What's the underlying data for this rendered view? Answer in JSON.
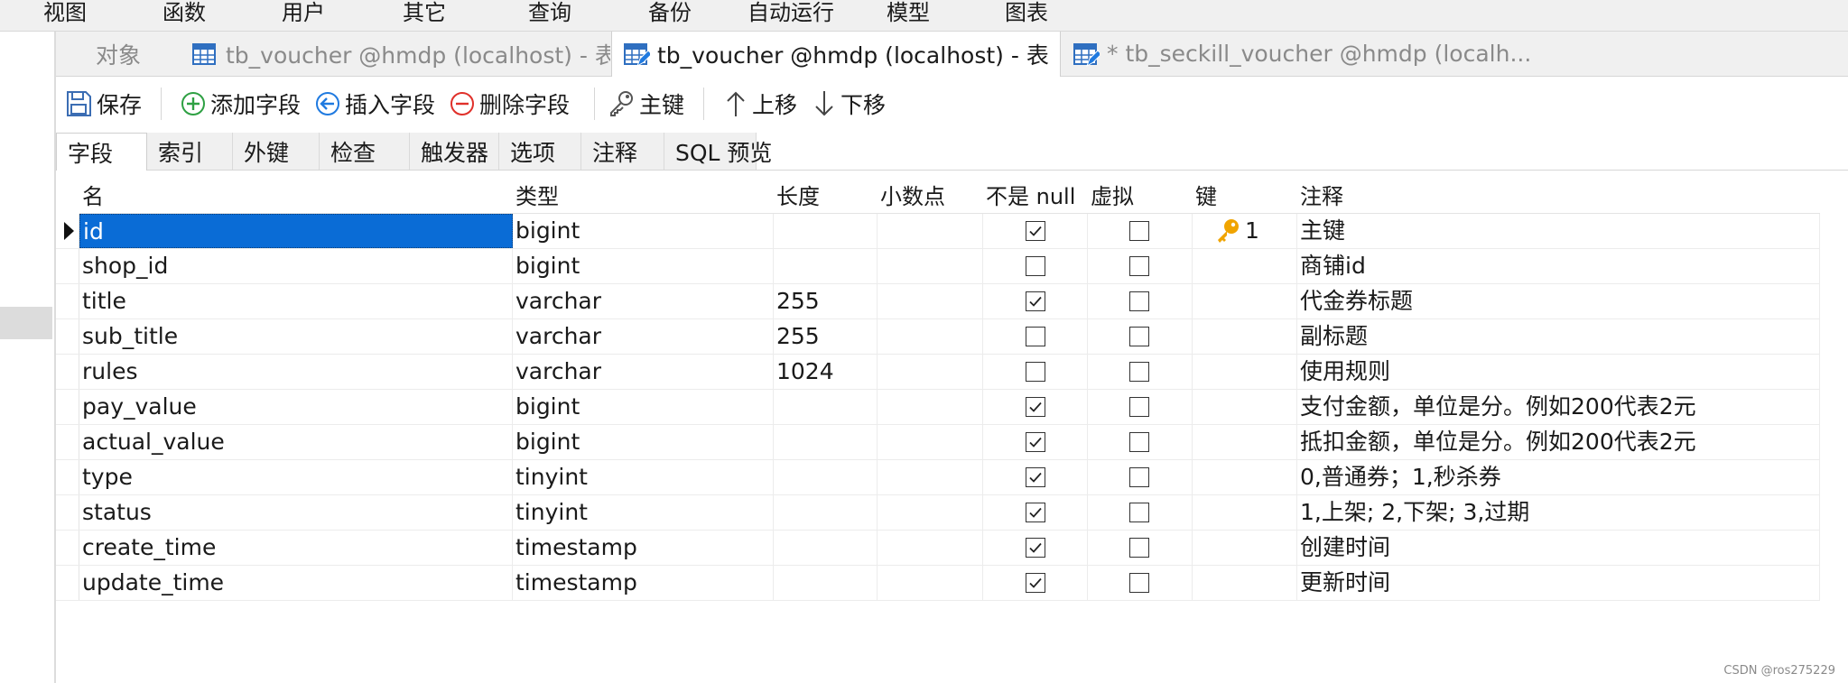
{
  "menu": [
    "视图",
    "函数",
    "用户",
    "其它",
    "查询",
    "备份",
    "自动运行",
    "模型",
    "图表"
  ],
  "tabs": [
    {
      "label": "对象",
      "state": "inactive"
    },
    {
      "label": "tb_voucher @hmdp (localhost) - 表",
      "state": "inactive",
      "icon": "table-icon"
    },
    {
      "label": "tb_voucher @hmdp (localhost) - 表",
      "state": "active",
      "icon": "table-design-icon"
    },
    {
      "label": "* tb_seckill_voucher @hmdp (localh...",
      "state": "inactive",
      "icon": "table-design-icon"
    }
  ],
  "toolbar": {
    "save": "保存",
    "add_field": "添加字段",
    "insert_field": "插入字段",
    "delete_field": "删除字段",
    "primary_key": "主键",
    "move_up": "上移",
    "move_down": "下移"
  },
  "sub_tabs": [
    "字段",
    "索引",
    "外键",
    "检查",
    "触发器",
    "选项",
    "注释",
    "SQL 预览"
  ],
  "columns": [
    "名",
    "类型",
    "长度",
    "小数点",
    "不是 null",
    "虚拟",
    "键",
    "注释"
  ],
  "rows": [
    {
      "name": "id",
      "type": "bigint",
      "length": "",
      "not_null": true,
      "virtual": false,
      "key": "1",
      "comment": "主键"
    },
    {
      "name": "shop_id",
      "type": "bigint",
      "length": "",
      "not_null": false,
      "virtual": false,
      "key": "",
      "comment": "商铺id"
    },
    {
      "name": "title",
      "type": "varchar",
      "length": "255",
      "not_null": true,
      "virtual": false,
      "key": "",
      "comment": "代金券标题"
    },
    {
      "name": "sub_title",
      "type": "varchar",
      "length": "255",
      "not_null": false,
      "virtual": false,
      "key": "",
      "comment": "副标题"
    },
    {
      "name": "rules",
      "type": "varchar",
      "length": "1024",
      "not_null": false,
      "virtual": false,
      "key": "",
      "comment": "使用规则"
    },
    {
      "name": "pay_value",
      "type": "bigint",
      "length": "",
      "not_null": true,
      "virtual": false,
      "key": "",
      "comment": "支付金额，单位是分。例如200代表2元"
    },
    {
      "name": "actual_value",
      "type": "bigint",
      "length": "",
      "not_null": true,
      "virtual": false,
      "key": "",
      "comment": "抵扣金额，单位是分。例如200代表2元"
    },
    {
      "name": "type",
      "type": "tinyint",
      "length": "",
      "not_null": true,
      "virtual": false,
      "key": "",
      "comment": "0,普通券；1,秒杀券"
    },
    {
      "name": "status",
      "type": "tinyint",
      "length": "",
      "not_null": true,
      "virtual": false,
      "key": "",
      "comment": "1,上架; 2,下架; 3,过期"
    },
    {
      "name": "create_time",
      "type": "timestamp",
      "length": "",
      "not_null": true,
      "virtual": false,
      "key": "",
      "comment": "创建时间"
    },
    {
      "name": "update_time",
      "type": "timestamp",
      "length": "",
      "not_null": true,
      "virtual": false,
      "key": "",
      "comment": "更新时间"
    }
  ],
  "selected_row": 0,
  "watermark": "CSDN @ros275229",
  "colors": {
    "selection": "#0a6cd6",
    "key_icon": "#f0a400",
    "add_icon": "#2ea043",
    "insert_icon": "#1f7ae0",
    "delete_icon": "#e0302a"
  }
}
